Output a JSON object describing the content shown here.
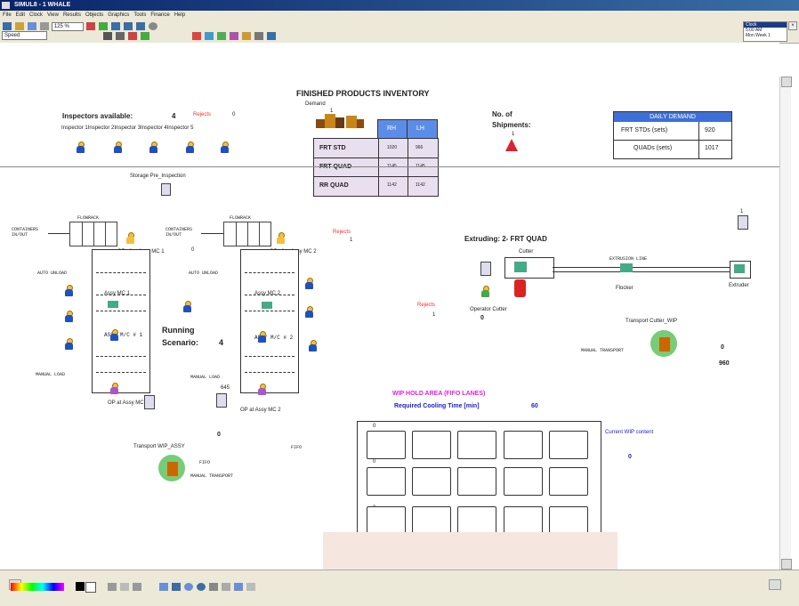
{
  "window": {
    "title": "SIMUL8 - 1  WHALE",
    "menu": [
      "File",
      "Edit",
      "Clock",
      "View",
      "Results",
      "Objects",
      "Graphics",
      "Tools",
      "Finance",
      "Help"
    ],
    "zoom": "125 %",
    "speed_label": "Speed",
    "clock": [
      "5:00 AM",
      "Mon Week 1"
    ]
  },
  "colors": {
    "accent": "#3a6ea5",
    "pink": "#e8e0ee",
    "daily_header": "#3d6fd6",
    "wip_title": "#e020e0",
    "wip_sub": "#1a1ad0",
    "bottom_panel": "#f5e6e0"
  },
  "inventory": {
    "title": "FINISHED PRODUCTS INVENTORY",
    "demand_label": "Demand",
    "demand_count": "1",
    "columns": [
      "RH",
      "LH"
    ],
    "rows": [
      {
        "label": "FRT STD",
        "rh": "1020",
        "lh": "966"
      },
      {
        "label": "FRT QUAD",
        "rh": "1145",
        "lh": "1145"
      },
      {
        "label": "RR QUAD",
        "rh": "1142",
        "lh": "1142"
      }
    ]
  },
  "shipments": {
    "label1": "No. of",
    "label2": "Shipments:",
    "count": "1"
  },
  "daily_demand": {
    "title": "DAILY DEMAND",
    "rows": [
      {
        "label": "FRT STDs (sets)",
        "value": "920"
      },
      {
        "label": "QUADs (sets)",
        "value": "1017"
      }
    ]
  },
  "inspectors": {
    "label": "Inspectors available:",
    "count": "4",
    "rejects_label": "Rejects",
    "rejects_value": "0",
    "names": "Inspector 1Inspector 2Inspector 3Inspector 4Inspector 5"
  },
  "storage_label": "Storage Pre_Inspection",
  "left_line": {
    "flowrack": "FLOWRACK",
    "containers": "CONTAINERS IN/OUT",
    "op_assy": "OP after Assy MC 1",
    "count_op": "0",
    "unload": "AUTO UNLOAD",
    "assy_mc": "Assy MC 1",
    "assy_mc_big": "ASSY M/C # 1",
    "manual_load": "MANUAL LOAD",
    "op_at": "OP at Assy MC",
    "transport": "Transport WIP_ASSY",
    "transport_count": "0",
    "fifo": "FIFO",
    "manual_transport": "MANUAL TRANSPORT",
    "fifo2": "FIFO"
  },
  "right_line": {
    "flowrack": "FLOWRACK",
    "containers": "CONTAINERS IN/OUT",
    "op_assy": "OP after Assy MC 2",
    "unload": "AUTO UNLOAD",
    "assy_mc": "Assy MC 2",
    "assy_mc_big": "ASSY M/C # 2",
    "manual_load": "MANUAL LOAD",
    "op_at": "OP at Assy MC 2",
    "count": "645",
    "rejects_label": "Rejects",
    "rejects_value": "1"
  },
  "running": {
    "label1": "Running",
    "label2": "Scenario:",
    "value": "4"
  },
  "extruding": {
    "title": "Extruding: 2- FRT QUAD",
    "cutter": "Cutter",
    "extrusion_line": "EXTRUSION LINE",
    "flocker": "Flocker",
    "extruder": "Extruder",
    "operator": "Operator Cutter",
    "operator_count": "0",
    "rejects_label": "Rejects",
    "rejects_value": "1",
    "transport": "Transport Cutter_WIP",
    "manual_transport": "MANUAL TRANSPORT",
    "count_a": "0",
    "count_b": "960",
    "small_count": "1"
  },
  "wip": {
    "title": "WIP HOLD AREA (FIFO LANES)",
    "cooling_label": "Required Cooling Time [min]",
    "cooling_value": "60",
    "current_label": "Current WIP content",
    "current_value": "0",
    "lane_counts": [
      "0",
      "0",
      "0"
    ]
  }
}
